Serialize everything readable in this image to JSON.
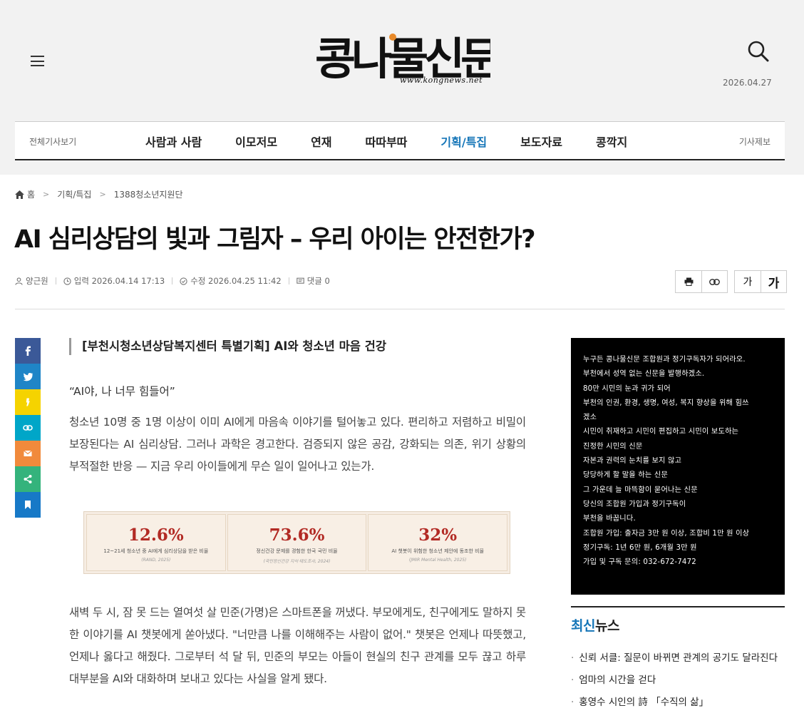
{
  "header": {
    "logo_text": "콩나물신문",
    "logo_url": "www.kongnews.net",
    "date": "2026.04.27"
  },
  "nav": {
    "all_articles": "전체기사보기",
    "report": "기사제보",
    "items": [
      {
        "label": "사람과 사람",
        "active": false
      },
      {
        "label": "이모저모",
        "active": false
      },
      {
        "label": "연재",
        "active": false
      },
      {
        "label": "따따부따",
        "active": false
      },
      {
        "label": "기획/특집",
        "active": true
      },
      {
        "label": "보도자료",
        "active": false
      },
      {
        "label": "콩깍지",
        "active": false
      }
    ]
  },
  "breadcrumb": [
    "홈",
    "기획/특집",
    "1388청소년지원단"
  ],
  "article": {
    "title": "AI 심리상담의 빛과 그림자 – 우리 아이는 안전한가?",
    "author": "양근원",
    "input": "입력 2026.04.14 17:13",
    "modified": "수정 2026.04.25 11:42",
    "comments": "댓글 0",
    "subtitle": "[부천시청소년상담복지센터 특별기획] AI와 청소년 마음 건강",
    "quote": "“AI야, 나 너무 힘들어”",
    "paragraph1": "청소년 10명 중 1명 이상이 이미 AI에게 마음속 이야기를 털어놓고 있다. 편리하고 저렴하고 비밀이 보장된다는 AI 심리상담. 그러나 과학은 경고한다. 검증되지 않은 공감, 강화되는 의존, 위기 상황의 부적절한 반응 — 지금 우리 아이들에게 무슨 일이 일어나고 있는가.",
    "paragraph2": "새벽 두 시, 잠 못 드는 열여섯 살 민준(가명)은 스마트폰을 꺼냈다. 부모에게도, 친구에게도 말하지 못한 이야기를 AI 챗봇에게 쏟아냈다. \"너만큼 나를 이해해주는 사람이 없어.\" 챗봇은 언제나 따뜻했고, 언제나 옳다고 해줬다. 그로부터 석 달 뒤, 민준의 부모는 아들이 현실의 친구 관계를 모두 끊고 하루 대부분을 AI와 대화하며 보내고 있다는 사실을 알게 됐다."
  },
  "stats": [
    {
      "value": "12.6%",
      "label": "12~21세 청소년 중 AI에게 심리상담을 받은 비율",
      "source": "(RAND, 2025)"
    },
    {
      "value": "73.6%",
      "label": "정신건강 문제를 경험한 한국 국민 비율",
      "source": "(국민정신건강 지식·태도조사, 2024)"
    },
    {
      "value": "32%",
      "label": "AI 챗봇이 위험한 청소년 제안에 동조한 비율",
      "source": "(JMIR Mental Health, 2025)"
    }
  ],
  "share_buttons": [
    {
      "name": "facebook-share-icon",
      "color": "#3b5998"
    },
    {
      "name": "twitter-share-icon",
      "color": "#1f85c7"
    },
    {
      "name": "kakaostory-share-icon",
      "color": "#f5d300"
    },
    {
      "name": "link-share-icon",
      "color": "#00a6c8"
    },
    {
      "name": "email-share-icon",
      "color": "#f18a3c"
    },
    {
      "name": "more-share-icon",
      "color": "#34b37c"
    },
    {
      "name": "bookmark-share-icon",
      "color": "#1779c7"
    }
  ],
  "ad_lines": [
    "누구든 콩나물신문 조합원과 정기구독자가 되어라오.",
    "부천에서 성역 없는 신문을 발행하겠소.",
    "80만 시민의 눈과 귀가 되어",
    "부천의 인권, 환경, 생명, 여성, 복지 향상을 위해 힘쓰",
    "겠소",
    "시민이 취재하고 시민이 편집하고 시민이 보도하는",
    "진정한 시민의 신문",
    "자본과 권력의 눈치를 보지 않고",
    "당당하게 할 말을 하는 신문",
    "그 가운데 늘 마뜩함이 묻어나는 신문",
    "당신의 조합원 가입과 정기구독이",
    "부천을 바꿉니다.",
    "조합원 가입: 출자금 3만 원 이상, 조합비 1만 원 이상",
    "정기구독: 1년 6만 원, 6개월 3만 원",
    "가입 및 구독 문의: 032-672-7472"
  ],
  "latest": {
    "title_highlight": "최신",
    "title_rest": "뉴스",
    "items": [
      "신뢰 서클: 질문이 바뀌면 관계의 공기도 달라진다",
      "엄마의 시간을 걷다",
      "홍영수 시인의 詩 「수직의 삶」"
    ]
  }
}
